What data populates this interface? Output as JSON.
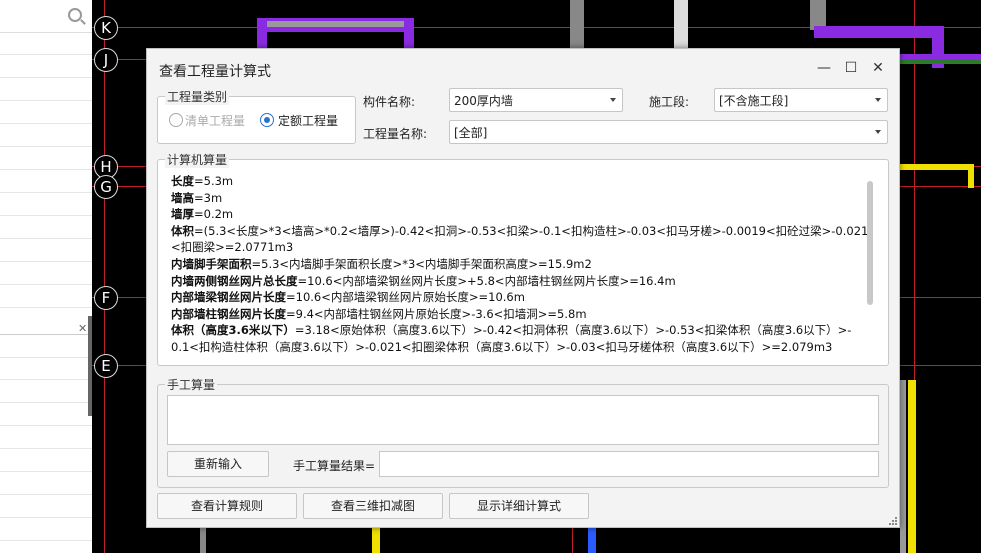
{
  "axes": {
    "k": "K",
    "j": "J",
    "h": "H",
    "g": "G",
    "f": "F",
    "e": "E"
  },
  "dialog": {
    "title": "查看工程量计算式",
    "category_label": "工程量类别",
    "radio_list": "清单工程量",
    "radio_quota": "定额工程量",
    "component_label": "构件名称:",
    "component_value": "200厚内墙",
    "stage_label": "施工段:",
    "stage_value": "[不含施工段]",
    "qty_name_label": "工程量名称:",
    "qty_name_value": "[全部]",
    "calc_label": "计算机算量",
    "calc_lines": [
      [
        {
          "b": "长度"
        },
        {
          "t": "=5.3m"
        }
      ],
      [
        {
          "b": "墙高"
        },
        {
          "t": "=3m"
        }
      ],
      [
        {
          "b": "墙厚"
        },
        {
          "t": "=0.2m"
        }
      ],
      [
        {
          "b": "体积"
        },
        {
          "t": "=(5.3<长度>*3<墙高>*0.2<墙厚>)-0.42<扣洞>-0.53<扣梁>-0.1<扣构造柱>-0.03<扣马牙槎>-0.0019<扣砼过梁>-0.021"
        }
      ],
      [
        {
          "t": "<扣圈梁>=2.0771m3"
        }
      ],
      [
        {
          "b": "内墙脚手架面积"
        },
        {
          "t": "=5.3<内墙脚手架面积长度>*3<内墙脚手架面积高度>=15.9m2"
        }
      ],
      [
        {
          "b": "内墙两侧钢丝网片总长度"
        },
        {
          "t": "=10.6<内部墙梁钢丝网片长度>+5.8<内部墙柱钢丝网片长度>=16.4m"
        }
      ],
      [
        {
          "b": "内部墙梁钢丝网片长度"
        },
        {
          "t": "=10.6<内部墙梁钢丝网片原始长度>=10.6m"
        }
      ],
      [
        {
          "b": "内部墙柱钢丝网片长度"
        },
        {
          "t": "=9.4<内部墙柱钢丝网片原始长度>-3.6<扣墙洞>=5.8m"
        }
      ],
      [
        {
          "b": "体积（高度3.6米以下）"
        },
        {
          "t": "=3.18<原始体积（高度3.6以下）>-0.42<扣洞体积（高度3.6以下）>-0.53<扣梁体积（高度3.6以下）>-"
        }
      ],
      [
        {
          "t": "0.1<扣构造柱体积（高度3.6以下）>-0.021<扣圈梁体积（高度3.6以下）>-0.03<扣马牙槎体积（高度3.6以下）>=2.079m3"
        }
      ]
    ],
    "manual_label": "手工算量",
    "reenter_button": "重新输入",
    "manual_result_label": "手工算量结果=",
    "rules_button": "查看计算规则",
    "view3d_button": "查看三维扣减图",
    "detail_button": "显示详细计算式"
  }
}
